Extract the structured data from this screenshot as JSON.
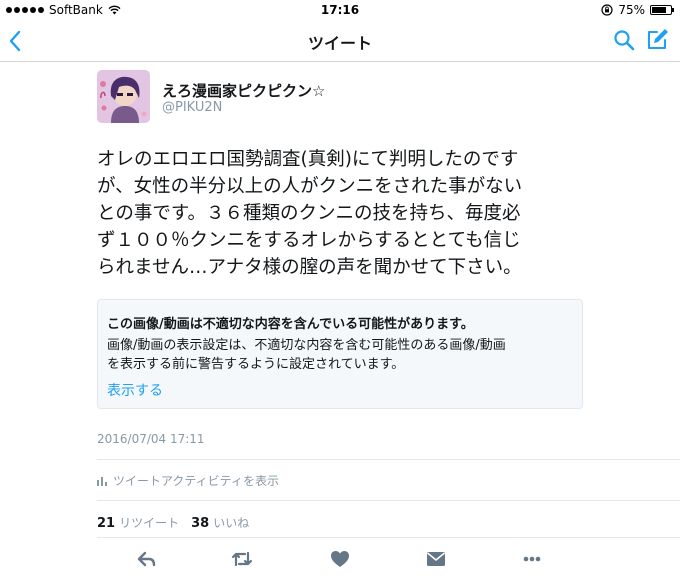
{
  "status_bar": {
    "carrier": "SoftBank",
    "time": "17:16",
    "battery": "75%",
    "battery_level": 0.75,
    "icons": [
      "signal-dots-icon",
      "wifi-icon",
      "orientation-lock-icon",
      "battery-icon"
    ]
  },
  "nav": {
    "title": "ツイート",
    "icons": [
      "chevron-left-icon",
      "search-icon",
      "compose-icon"
    ]
  },
  "tweet": {
    "display_name": "えろ漫画家ピクピクン☆",
    "handle": "@PIKU2N",
    "text_lines": [
      "オレのエロエロ国勢調査(真剣)にて判明したのです",
      "が、女性の半分以上の人がクンニをされた事がない",
      "との事です。３６種類のクンニの技を持ち、毎度必",
      "ず１００％クンニをするオレからするととても信じ",
      "られません…アナタ様の膣の声を聞かせて下さい。"
    ],
    "warning": {
      "title": "この画像/動画は不適切な内容を含んでいる可能性があります。",
      "body_lines": [
        "画像/動画の表示設定は、不適切な内容を含む可能性のある画像/動画",
        "を表示する前に警告するように設定されています。"
      ],
      "link": "表示する"
    },
    "timestamp": "2016/07/04 17:11",
    "activity_label": "ツイートアクティビティを表示",
    "retweet_count": "21",
    "retweet_label": "リツイート",
    "like_count": "38",
    "like_label": "いいね"
  },
  "actions": [
    "reply-icon",
    "retweet-icon",
    "like-icon",
    "dm-icon",
    "share-icon"
  ],
  "colors": {
    "accent": "#1da1f2",
    "secondary_text": "#8899a6",
    "icon_gray": "#657786",
    "divider": "#e1e8ed"
  }
}
